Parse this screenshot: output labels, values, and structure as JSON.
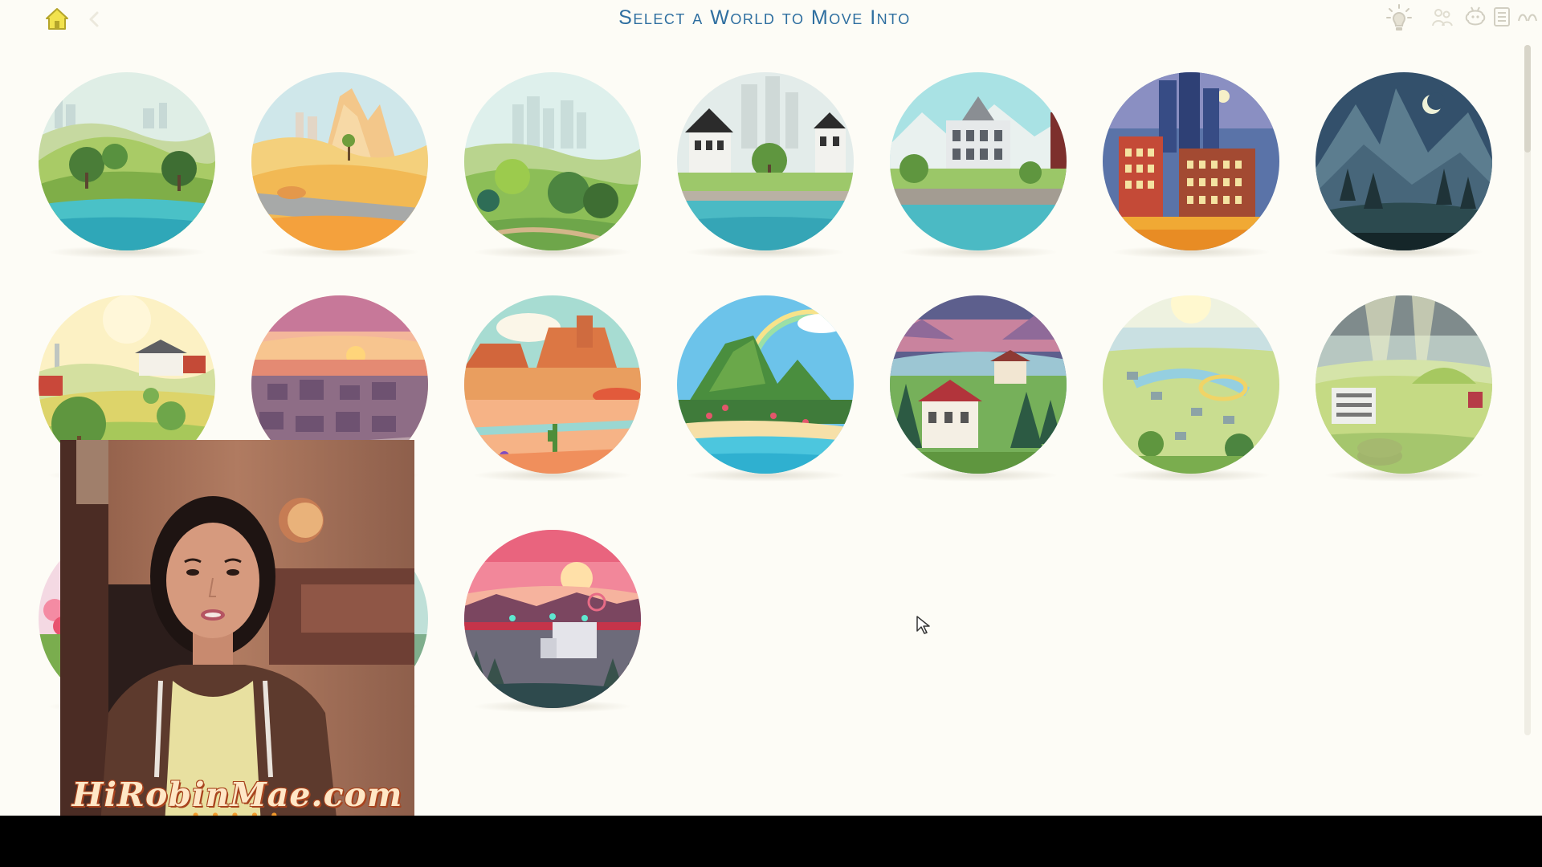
{
  "header": {
    "title": "Select a World to Move Into"
  },
  "icons": {
    "home": "home-icon",
    "back": "back-arrow-icon",
    "lightbulb": "lightbulb-icon",
    "family": "family-icon",
    "notifications": "notification-icon",
    "list": "list-icon",
    "more": "more-icon"
  },
  "world_grid": {
    "columns": 7,
    "rows": 3,
    "worlds": [
      "world-1",
      "world-2",
      "world-3",
      "world-4",
      "world-5",
      "world-6",
      "world-7",
      "world-8",
      "world-9",
      "world-10",
      "world-11",
      "world-12",
      "world-13",
      "world-14",
      "world-15",
      "world-16",
      "world-17"
    ]
  },
  "webcam_overlay": {
    "watermark": "HiRobinMae.com",
    "flowers": "✿✿✿✿✿"
  },
  "colors": {
    "background": "#fdfcf6",
    "title": "#2f6fa0",
    "home_icon": "#d4c23a"
  }
}
